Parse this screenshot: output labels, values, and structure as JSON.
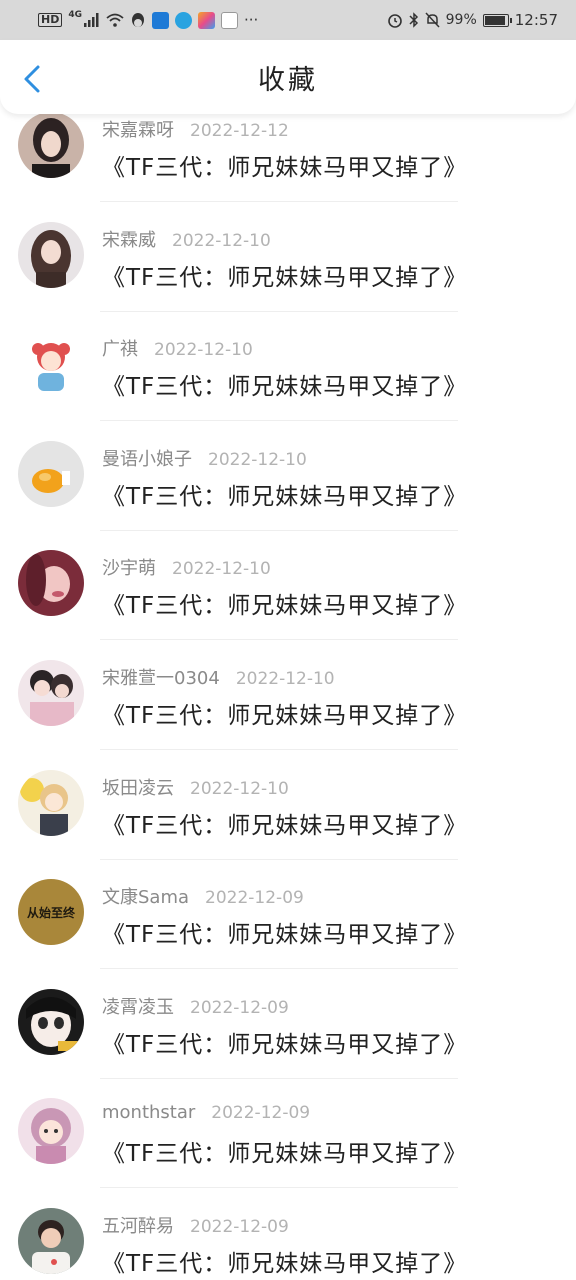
{
  "status_bar": {
    "hd": "HD",
    "network": "4G",
    "battery": "99%",
    "time": "12:57",
    "more": "···"
  },
  "header": {
    "title": "收藏",
    "back_icon": "chevron-left-icon"
  },
  "colors": {
    "accent": "#2f8fe0",
    "username": "#8a8a8a",
    "date": "#b3b3b3",
    "title": "#222222"
  },
  "favorites": [
    {
      "user": "宋嘉霖呀",
      "date": "2022-12-12",
      "title": "《TF三代：师兄妹妹马甲又掉了》"
    },
    {
      "user": "宋霖威",
      "date": "2022-12-10",
      "title": "《TF三代：师兄妹妹马甲又掉了》"
    },
    {
      "user": "广祺",
      "date": "2022-12-10",
      "title": "《TF三代：师兄妹妹马甲又掉了》"
    },
    {
      "user": "曼语小娘子",
      "date": "2022-12-10",
      "title": "《TF三代：师兄妹妹马甲又掉了》"
    },
    {
      "user": "沙宇萌",
      "date": "2022-12-10",
      "title": "《TF三代：师兄妹妹马甲又掉了》"
    },
    {
      "user": "宋雅萱一0304",
      "date": "2022-12-10",
      "title": "《TF三代：师兄妹妹马甲又掉了》"
    },
    {
      "user": "坂田凌云",
      "date": "2022-12-10",
      "title": "《TF三代：师兄妹妹马甲又掉了》"
    },
    {
      "user": "文康Sama",
      "date": "2022-12-09",
      "title": "《TF三代：师兄妹妹马甲又掉了》",
      "avatar_text": "从始至终"
    },
    {
      "user": "凌霄凌玉",
      "date": "2022-12-09",
      "title": "《TF三代：师兄妹妹马甲又掉了》"
    },
    {
      "user": "monthstar",
      "date": "2022-12-09",
      "title": "《TF三代：师兄妹妹马甲又掉了》"
    },
    {
      "user": "五河醉易",
      "date": "2022-12-09",
      "title": "《TF三代：师兄妹妹马甲又掉了》"
    }
  ]
}
